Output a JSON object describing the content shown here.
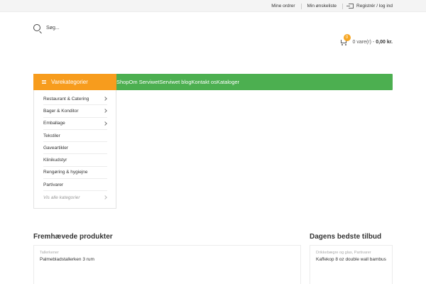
{
  "topbar": {
    "orders": "Mine ordrer",
    "wishlist": "Min ønskeliste",
    "register": "Registrér / log ind"
  },
  "search": {
    "placeholder": "Søg..."
  },
  "cart": {
    "badge": "0",
    "count": "0 vare(r) -",
    "total": "0,00 kr."
  },
  "nav": {
    "categories_label": "Varekategorier",
    "menu": [
      "Shop",
      "Om Serviwet",
      "Serviwet blog",
      "Kontakt os",
      "Kataloger"
    ]
  },
  "categories": [
    {
      "label": "Restaurant & Catering",
      "has_sub": true
    },
    {
      "label": "Bager & Konditor",
      "has_sub": true
    },
    {
      "label": "Emballage",
      "has_sub": true
    },
    {
      "label": "Tekstiler",
      "has_sub": false
    },
    {
      "label": "Gaveartikler",
      "has_sub": false
    },
    {
      "label": "Klinikudstyr",
      "has_sub": false
    },
    {
      "label": "Rengøring & hygiejne",
      "has_sub": false
    },
    {
      "label": "Partivarer",
      "has_sub": false
    },
    {
      "label": "Vis alle kategorier",
      "has_sub": true
    }
  ],
  "featured": {
    "title": "Fremhævede produkter",
    "product": {
      "category": "Tallerkener",
      "name": "Palmebladstallerken 3 rum"
    }
  },
  "deals": {
    "title": "Dagens bedste tilbud",
    "product": {
      "category": "Drikkebægre og glas, Partivarer",
      "name": "Kaffekop 8 oz double wall bambus"
    }
  },
  "colors": {
    "nav_green": "#4caf50",
    "category_orange": "#f79c1d",
    "badge_orange": "#f6a623"
  }
}
